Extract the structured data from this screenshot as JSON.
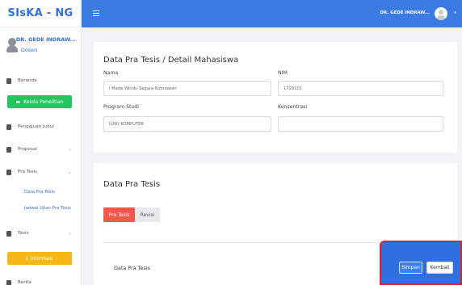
{
  "app": {
    "brand": "SIsKA - NG"
  },
  "user": {
    "name": "DR. GEDE INDRAW...",
    "role": "Dosen",
    "topbar_name": "DR. GEDE INDRAW..."
  },
  "sidebar": {
    "items": [
      {
        "label": "Beranda",
        "icon": "home-icon"
      },
      {
        "label": "Kelola Penelitian",
        "icon": "monitor-icon",
        "style": "green-button"
      },
      {
        "label": "Pengajuan Judul",
        "icon": "document-icon"
      },
      {
        "label": "Proposal",
        "icon": "document-icon",
        "chevron": "›"
      },
      {
        "label": "Pra Tesis",
        "icon": "document-icon",
        "chevron": "⌄"
      },
      {
        "label": "Data Pra Tesis",
        "style": "subitem"
      },
      {
        "label": "Jadwal Ujian Pra Tesis",
        "style": "subitem"
      },
      {
        "label": "Tesis",
        "icon": "document-icon",
        "chevron": "›"
      },
      {
        "label": "Informasi",
        "icon": "info-icon",
        "style": "orange-button"
      },
      {
        "label": "Berita",
        "icon": "news-icon"
      }
    ]
  },
  "main": {
    "breadcrumb_title": "Data Pra Tesis / Detail Mahasiswa",
    "fields": {
      "nama": {
        "label": "Nama",
        "value": "I Made Windu Segara Kumiawan"
      },
      "nim": {
        "label": "NIM",
        "value": "1729101"
      },
      "program_studi": {
        "label": "Program Studi",
        "value": "ILMU KOMPUTER"
      },
      "konsentrasi": {
        "label": "Konsentrasi",
        "value": ""
      }
    },
    "section": {
      "title": "Data Pra Tesis",
      "tabs": [
        {
          "label": "Pra Tesis",
          "active": true
        },
        {
          "label": "Revisi",
          "active": false
        }
      ],
      "subsection_title": "Data Pra Tesis"
    },
    "actions": {
      "save_label": "Simpan",
      "back_label": "Kembali"
    }
  },
  "colors": {
    "primary": "#3b7be3",
    "green": "#22c55e",
    "orange": "#f5b716",
    "tab_active": "#f2594b",
    "highlight_border": "#e02020"
  }
}
